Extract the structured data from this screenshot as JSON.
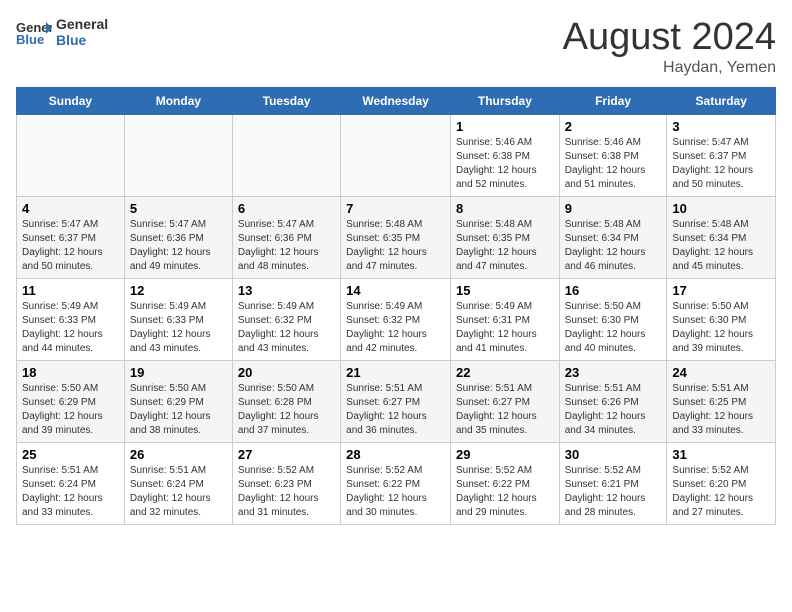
{
  "header": {
    "logo_general": "General",
    "logo_blue": "Blue",
    "main_title": "August 2024",
    "subtitle": "Haydan, Yemen"
  },
  "weekdays": [
    "Sunday",
    "Monday",
    "Tuesday",
    "Wednesday",
    "Thursday",
    "Friday",
    "Saturday"
  ],
  "weeks": [
    [
      {
        "day": "",
        "info": ""
      },
      {
        "day": "",
        "info": ""
      },
      {
        "day": "",
        "info": ""
      },
      {
        "day": "",
        "info": ""
      },
      {
        "day": "1",
        "info": "Sunrise: 5:46 AM\nSunset: 6:38 PM\nDaylight: 12 hours\nand 52 minutes."
      },
      {
        "day": "2",
        "info": "Sunrise: 5:46 AM\nSunset: 6:38 PM\nDaylight: 12 hours\nand 51 minutes."
      },
      {
        "day": "3",
        "info": "Sunrise: 5:47 AM\nSunset: 6:37 PM\nDaylight: 12 hours\nand 50 minutes."
      }
    ],
    [
      {
        "day": "4",
        "info": "Sunrise: 5:47 AM\nSunset: 6:37 PM\nDaylight: 12 hours\nand 50 minutes."
      },
      {
        "day": "5",
        "info": "Sunrise: 5:47 AM\nSunset: 6:36 PM\nDaylight: 12 hours\nand 49 minutes."
      },
      {
        "day": "6",
        "info": "Sunrise: 5:47 AM\nSunset: 6:36 PM\nDaylight: 12 hours\nand 48 minutes."
      },
      {
        "day": "7",
        "info": "Sunrise: 5:48 AM\nSunset: 6:35 PM\nDaylight: 12 hours\nand 47 minutes."
      },
      {
        "day": "8",
        "info": "Sunrise: 5:48 AM\nSunset: 6:35 PM\nDaylight: 12 hours\nand 47 minutes."
      },
      {
        "day": "9",
        "info": "Sunrise: 5:48 AM\nSunset: 6:34 PM\nDaylight: 12 hours\nand 46 minutes."
      },
      {
        "day": "10",
        "info": "Sunrise: 5:48 AM\nSunset: 6:34 PM\nDaylight: 12 hours\nand 45 minutes."
      }
    ],
    [
      {
        "day": "11",
        "info": "Sunrise: 5:49 AM\nSunset: 6:33 PM\nDaylight: 12 hours\nand 44 minutes."
      },
      {
        "day": "12",
        "info": "Sunrise: 5:49 AM\nSunset: 6:33 PM\nDaylight: 12 hours\nand 43 minutes."
      },
      {
        "day": "13",
        "info": "Sunrise: 5:49 AM\nSunset: 6:32 PM\nDaylight: 12 hours\nand 43 minutes."
      },
      {
        "day": "14",
        "info": "Sunrise: 5:49 AM\nSunset: 6:32 PM\nDaylight: 12 hours\nand 42 minutes."
      },
      {
        "day": "15",
        "info": "Sunrise: 5:49 AM\nSunset: 6:31 PM\nDaylight: 12 hours\nand 41 minutes."
      },
      {
        "day": "16",
        "info": "Sunrise: 5:50 AM\nSunset: 6:30 PM\nDaylight: 12 hours\nand 40 minutes."
      },
      {
        "day": "17",
        "info": "Sunrise: 5:50 AM\nSunset: 6:30 PM\nDaylight: 12 hours\nand 39 minutes."
      }
    ],
    [
      {
        "day": "18",
        "info": "Sunrise: 5:50 AM\nSunset: 6:29 PM\nDaylight: 12 hours\nand 39 minutes."
      },
      {
        "day": "19",
        "info": "Sunrise: 5:50 AM\nSunset: 6:29 PM\nDaylight: 12 hours\nand 38 minutes."
      },
      {
        "day": "20",
        "info": "Sunrise: 5:50 AM\nSunset: 6:28 PM\nDaylight: 12 hours\nand 37 minutes."
      },
      {
        "day": "21",
        "info": "Sunrise: 5:51 AM\nSunset: 6:27 PM\nDaylight: 12 hours\nand 36 minutes."
      },
      {
        "day": "22",
        "info": "Sunrise: 5:51 AM\nSunset: 6:27 PM\nDaylight: 12 hours\nand 35 minutes."
      },
      {
        "day": "23",
        "info": "Sunrise: 5:51 AM\nSunset: 6:26 PM\nDaylight: 12 hours\nand 34 minutes."
      },
      {
        "day": "24",
        "info": "Sunrise: 5:51 AM\nSunset: 6:25 PM\nDaylight: 12 hours\nand 33 minutes."
      }
    ],
    [
      {
        "day": "25",
        "info": "Sunrise: 5:51 AM\nSunset: 6:24 PM\nDaylight: 12 hours\nand 33 minutes."
      },
      {
        "day": "26",
        "info": "Sunrise: 5:51 AM\nSunset: 6:24 PM\nDaylight: 12 hours\nand 32 minutes."
      },
      {
        "day": "27",
        "info": "Sunrise: 5:52 AM\nSunset: 6:23 PM\nDaylight: 12 hours\nand 31 minutes."
      },
      {
        "day": "28",
        "info": "Sunrise: 5:52 AM\nSunset: 6:22 PM\nDaylight: 12 hours\nand 30 minutes."
      },
      {
        "day": "29",
        "info": "Sunrise: 5:52 AM\nSunset: 6:22 PM\nDaylight: 12 hours\nand 29 minutes."
      },
      {
        "day": "30",
        "info": "Sunrise: 5:52 AM\nSunset: 6:21 PM\nDaylight: 12 hours\nand 28 minutes."
      },
      {
        "day": "31",
        "info": "Sunrise: 5:52 AM\nSunset: 6:20 PM\nDaylight: 12 hours\nand 27 minutes."
      }
    ]
  ]
}
